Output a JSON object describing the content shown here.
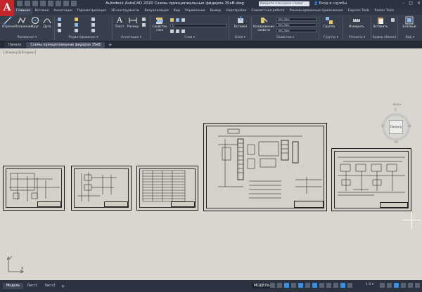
{
  "app": {
    "logo_letter": "A",
    "title": "Autodesk AutoCAD 2020   Схемы принципиальные фидеров 35кВ.dwg",
    "search_placeholder": "Введите ключевое слово/фразу",
    "user_label": "Вход в службы",
    "win_min": "–",
    "win_max": "□",
    "win_close": "×"
  },
  "ribbon_tabs": [
    {
      "label": "Главная",
      "active": true
    },
    {
      "label": "Вставка"
    },
    {
      "label": "Аннотации"
    },
    {
      "label": "Параметризация"
    },
    {
      "label": "3D-инструменты"
    },
    {
      "label": "Визуализация"
    },
    {
      "label": "Вид"
    },
    {
      "label": "Управление"
    },
    {
      "label": "Вывод"
    },
    {
      "label": "Надстройки"
    },
    {
      "label": "Совместная работа"
    },
    {
      "label": "Рекомендованные приложения"
    },
    {
      "label": "Express Tools"
    },
    {
      "label": "Raster Tools"
    }
  ],
  "ribbon": {
    "draw": {
      "group": "Рисование ▾",
      "otrezok": "Отрезок",
      "polyline": "Полилиния",
      "circle": "Круг",
      "arc": "Дуга"
    },
    "modify": {
      "group": "Редактирование ▾"
    },
    "annotation": {
      "group": "Аннотации ▾",
      "text": "Текст",
      "dim": "Размер"
    },
    "layers": {
      "group": "Слои ▾",
      "props": "Свойства слоя",
      "layer_value": "0"
    },
    "block": {
      "group": "Блок ▾",
      "insert": "Вставка"
    },
    "properties": {
      "group": "Свойства ▾",
      "match": "Копирование свойств",
      "bylayer1": "ПоСлою",
      "bylayer2": "ПоСлою",
      "bylayer3": "ПоСлою"
    },
    "groups": {
      "group": "Группы ▾",
      "label": "Группа"
    },
    "utilities": {
      "group": "Утилиты ▾",
      "measure": "Измерить"
    },
    "clipboard": {
      "group": "Буфер обмена",
      "paste": "Вставить"
    },
    "view": {
      "group": "Вид ▾",
      "base": "Базовый"
    }
  },
  "file_tabs": [
    {
      "label": "Начало"
    },
    {
      "label": "Схемы принципиальные фидеров 35кВ",
      "active": true
    }
  ],
  "new_tab": "+",
  "canvas": {
    "view_label": "[-][Сверху][2D-каркас]",
    "viewcube": {
      "top": "Сверху",
      "n": "С",
      "s": "Ю",
      "w": "З",
      "e": "В",
      "wcs": "МСК ▾"
    }
  },
  "status": {
    "layouts": [
      {
        "label": "Модель",
        "active": true
      },
      {
        "label": "Лист1"
      },
      {
        "label": "Лист2"
      }
    ],
    "add_layout": "+",
    "model_label": "МОДЕЛЬ",
    "scale": "1:1 ▾"
  }
}
